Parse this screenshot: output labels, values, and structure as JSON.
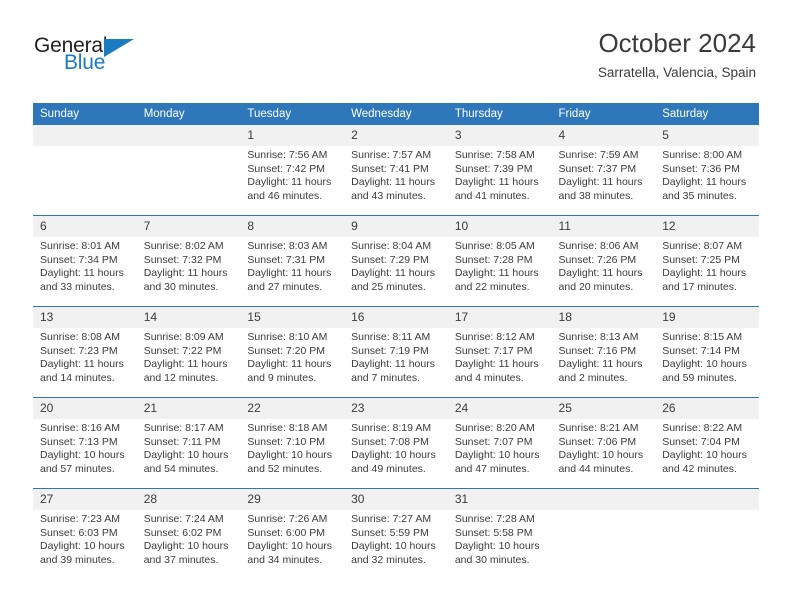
{
  "brand": {
    "name_part1": "General",
    "name_part2": "Blue",
    "triangle_icon": "triangle-icon",
    "color_primary": "#1a7bc0",
    "color_text": "#231f20"
  },
  "header": {
    "title": "October 2024",
    "subtitle": "Sarratella, Valencia, Spain"
  },
  "theme": {
    "header_blue": "#2e77ba",
    "daynum_band": "#f1f1f1",
    "text": "#3b3b3b"
  },
  "calendar": {
    "weekday_headers": [
      "Sunday",
      "Monday",
      "Tuesday",
      "Wednesday",
      "Thursday",
      "Friday",
      "Saturday"
    ],
    "weeks": [
      [
        {
          "day": "",
          "empty": true,
          "sunrise": "",
          "sunset": "",
          "daylight_line1": "",
          "daylight_line2": ""
        },
        {
          "day": "",
          "empty": true,
          "sunrise": "",
          "sunset": "",
          "daylight_line1": "",
          "daylight_line2": ""
        },
        {
          "day": "1",
          "empty": false,
          "sunrise": "Sunrise: 7:56 AM",
          "sunset": "Sunset: 7:42 PM",
          "daylight_line1": "Daylight: 11 hours",
          "daylight_line2": "and 46 minutes."
        },
        {
          "day": "2",
          "empty": false,
          "sunrise": "Sunrise: 7:57 AM",
          "sunset": "Sunset: 7:41 PM",
          "daylight_line1": "Daylight: 11 hours",
          "daylight_line2": "and 43 minutes."
        },
        {
          "day": "3",
          "empty": false,
          "sunrise": "Sunrise: 7:58 AM",
          "sunset": "Sunset: 7:39 PM",
          "daylight_line1": "Daylight: 11 hours",
          "daylight_line2": "and 41 minutes."
        },
        {
          "day": "4",
          "empty": false,
          "sunrise": "Sunrise: 7:59 AM",
          "sunset": "Sunset: 7:37 PM",
          "daylight_line1": "Daylight: 11 hours",
          "daylight_line2": "and 38 minutes."
        },
        {
          "day": "5",
          "empty": false,
          "sunrise": "Sunrise: 8:00 AM",
          "sunset": "Sunset: 7:36 PM",
          "daylight_line1": "Daylight: 11 hours",
          "daylight_line2": "and 35 minutes."
        }
      ],
      [
        {
          "day": "6",
          "empty": false,
          "sunrise": "Sunrise: 8:01 AM",
          "sunset": "Sunset: 7:34 PM",
          "daylight_line1": "Daylight: 11 hours",
          "daylight_line2": "and 33 minutes."
        },
        {
          "day": "7",
          "empty": false,
          "sunrise": "Sunrise: 8:02 AM",
          "sunset": "Sunset: 7:32 PM",
          "daylight_line1": "Daylight: 11 hours",
          "daylight_line2": "and 30 minutes."
        },
        {
          "day": "8",
          "empty": false,
          "sunrise": "Sunrise: 8:03 AM",
          "sunset": "Sunset: 7:31 PM",
          "daylight_line1": "Daylight: 11 hours",
          "daylight_line2": "and 27 minutes."
        },
        {
          "day": "9",
          "empty": false,
          "sunrise": "Sunrise: 8:04 AM",
          "sunset": "Sunset: 7:29 PM",
          "daylight_line1": "Daylight: 11 hours",
          "daylight_line2": "and 25 minutes."
        },
        {
          "day": "10",
          "empty": false,
          "sunrise": "Sunrise: 8:05 AM",
          "sunset": "Sunset: 7:28 PM",
          "daylight_line1": "Daylight: 11 hours",
          "daylight_line2": "and 22 minutes."
        },
        {
          "day": "11",
          "empty": false,
          "sunrise": "Sunrise: 8:06 AM",
          "sunset": "Sunset: 7:26 PM",
          "daylight_line1": "Daylight: 11 hours",
          "daylight_line2": "and 20 minutes."
        },
        {
          "day": "12",
          "empty": false,
          "sunrise": "Sunrise: 8:07 AM",
          "sunset": "Sunset: 7:25 PM",
          "daylight_line1": "Daylight: 11 hours",
          "daylight_line2": "and 17 minutes."
        }
      ],
      [
        {
          "day": "13",
          "empty": false,
          "sunrise": "Sunrise: 8:08 AM",
          "sunset": "Sunset: 7:23 PM",
          "daylight_line1": "Daylight: 11 hours",
          "daylight_line2": "and 14 minutes."
        },
        {
          "day": "14",
          "empty": false,
          "sunrise": "Sunrise: 8:09 AM",
          "sunset": "Sunset: 7:22 PM",
          "daylight_line1": "Daylight: 11 hours",
          "daylight_line2": "and 12 minutes."
        },
        {
          "day": "15",
          "empty": false,
          "sunrise": "Sunrise: 8:10 AM",
          "sunset": "Sunset: 7:20 PM",
          "daylight_line1": "Daylight: 11 hours",
          "daylight_line2": "and 9 minutes."
        },
        {
          "day": "16",
          "empty": false,
          "sunrise": "Sunrise: 8:11 AM",
          "sunset": "Sunset: 7:19 PM",
          "daylight_line1": "Daylight: 11 hours",
          "daylight_line2": "and 7 minutes."
        },
        {
          "day": "17",
          "empty": false,
          "sunrise": "Sunrise: 8:12 AM",
          "sunset": "Sunset: 7:17 PM",
          "daylight_line1": "Daylight: 11 hours",
          "daylight_line2": "and 4 minutes."
        },
        {
          "day": "18",
          "empty": false,
          "sunrise": "Sunrise: 8:13 AM",
          "sunset": "Sunset: 7:16 PM",
          "daylight_line1": "Daylight: 11 hours",
          "daylight_line2": "and 2 minutes."
        },
        {
          "day": "19",
          "empty": false,
          "sunrise": "Sunrise: 8:15 AM",
          "sunset": "Sunset: 7:14 PM",
          "daylight_line1": "Daylight: 10 hours",
          "daylight_line2": "and 59 minutes."
        }
      ],
      [
        {
          "day": "20",
          "empty": false,
          "sunrise": "Sunrise: 8:16 AM",
          "sunset": "Sunset: 7:13 PM",
          "daylight_line1": "Daylight: 10 hours",
          "daylight_line2": "and 57 minutes."
        },
        {
          "day": "21",
          "empty": false,
          "sunrise": "Sunrise: 8:17 AM",
          "sunset": "Sunset: 7:11 PM",
          "daylight_line1": "Daylight: 10 hours",
          "daylight_line2": "and 54 minutes."
        },
        {
          "day": "22",
          "empty": false,
          "sunrise": "Sunrise: 8:18 AM",
          "sunset": "Sunset: 7:10 PM",
          "daylight_line1": "Daylight: 10 hours",
          "daylight_line2": "and 52 minutes."
        },
        {
          "day": "23",
          "empty": false,
          "sunrise": "Sunrise: 8:19 AM",
          "sunset": "Sunset: 7:08 PM",
          "daylight_line1": "Daylight: 10 hours",
          "daylight_line2": "and 49 minutes."
        },
        {
          "day": "24",
          "empty": false,
          "sunrise": "Sunrise: 8:20 AM",
          "sunset": "Sunset: 7:07 PM",
          "daylight_line1": "Daylight: 10 hours",
          "daylight_line2": "and 47 minutes."
        },
        {
          "day": "25",
          "empty": false,
          "sunrise": "Sunrise: 8:21 AM",
          "sunset": "Sunset: 7:06 PM",
          "daylight_line1": "Daylight: 10 hours",
          "daylight_line2": "and 44 minutes."
        },
        {
          "day": "26",
          "empty": false,
          "sunrise": "Sunrise: 8:22 AM",
          "sunset": "Sunset: 7:04 PM",
          "daylight_line1": "Daylight: 10 hours",
          "daylight_line2": "and 42 minutes."
        }
      ],
      [
        {
          "day": "27",
          "empty": false,
          "sunrise": "Sunrise: 7:23 AM",
          "sunset": "Sunset: 6:03 PM",
          "daylight_line1": "Daylight: 10 hours",
          "daylight_line2": "and 39 minutes."
        },
        {
          "day": "28",
          "empty": false,
          "sunrise": "Sunrise: 7:24 AM",
          "sunset": "Sunset: 6:02 PM",
          "daylight_line1": "Daylight: 10 hours",
          "daylight_line2": "and 37 minutes."
        },
        {
          "day": "29",
          "empty": false,
          "sunrise": "Sunrise: 7:26 AM",
          "sunset": "Sunset: 6:00 PM",
          "daylight_line1": "Daylight: 10 hours",
          "daylight_line2": "and 34 minutes."
        },
        {
          "day": "30",
          "empty": false,
          "sunrise": "Sunrise: 7:27 AM",
          "sunset": "Sunset: 5:59 PM",
          "daylight_line1": "Daylight: 10 hours",
          "daylight_line2": "and 32 minutes."
        },
        {
          "day": "31",
          "empty": false,
          "sunrise": "Sunrise: 7:28 AM",
          "sunset": "Sunset: 5:58 PM",
          "daylight_line1": "Daylight: 10 hours",
          "daylight_line2": "and 30 minutes."
        },
        {
          "day": "",
          "empty": true,
          "sunrise": "",
          "sunset": "",
          "daylight_line1": "",
          "daylight_line2": ""
        },
        {
          "day": "",
          "empty": true,
          "sunrise": "",
          "sunset": "",
          "daylight_line1": "",
          "daylight_line2": ""
        }
      ]
    ]
  }
}
